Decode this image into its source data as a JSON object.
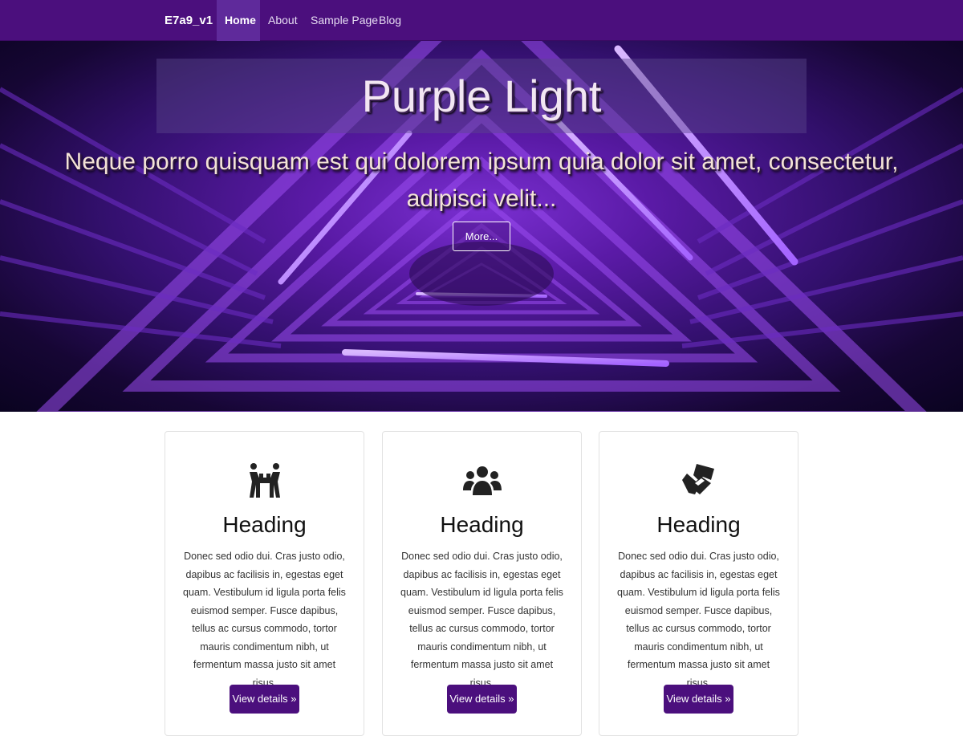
{
  "navbar": {
    "brand": "E7a9_v1",
    "items": [
      {
        "label": "Home",
        "active": true
      },
      {
        "label": "About",
        "active": false
      },
      {
        "label": "Sample Page",
        "active": false
      },
      {
        "label": "Blog",
        "active": false
      }
    ]
  },
  "hero": {
    "title": "Purple Light",
    "subtitle": "Neque porro quisquam est qui dolorem ipsum quia dolor sit amet, consectetur, adipisci velit...",
    "button_label": "More..."
  },
  "cards": [
    {
      "icon": "people-carry-icon",
      "heading": "Heading",
      "text": "Donec sed odio dui. Cras justo odio, dapibus ac facilisis in, egestas eget quam. Vestibulum id ligula porta felis euismod semper. Fusce dapibus, tellus ac cursus commodo, tortor mauris condimentum nibh, ut fermentum massa justo sit amet risus.",
      "button_label": "View details »"
    },
    {
      "icon": "users-icon",
      "heading": "Heading",
      "text": "Donec sed odio dui. Cras justo odio, dapibus ac facilisis in, egestas eget quam. Vestibulum id ligula porta felis euismod semper. Fusce dapibus, tellus ac cursus commodo, tortor mauris condimentum nibh, ut fermentum massa justo sit amet risus.",
      "button_label": "View details »"
    },
    {
      "icon": "handshake-icon",
      "heading": "Heading",
      "text": "Donec sed odio dui. Cras justo odio, dapibus ac facilisis in, egestas eget quam. Vestibulum id ligula porta felis euismod semper. Fusce dapibus, tellus ac cursus commodo, tortor mauris condimentum nibh, ut fermentum massa justo sit amet risus.",
      "button_label": "View details »"
    }
  ],
  "colors": {
    "navbar_bg": "#4b0f7d",
    "button_bg": "#4b0f7d",
    "hero_accent": "#7a2fd1"
  }
}
